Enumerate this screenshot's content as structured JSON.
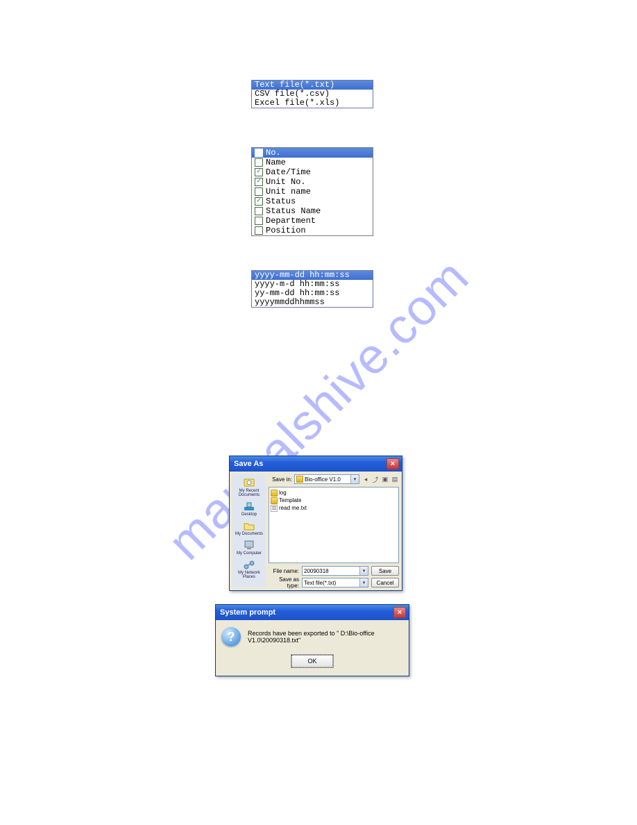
{
  "watermark": "manualshive.com",
  "filetype_list": {
    "items": [
      {
        "label": "Text file(*.txt)",
        "selected": true
      },
      {
        "label": "CSV file(*.csv)",
        "selected": false
      },
      {
        "label": "Excel file(*.xls)",
        "selected": false
      }
    ]
  },
  "field_list": {
    "items": [
      {
        "label": "No.",
        "checked": true,
        "selected": true
      },
      {
        "label": "Name",
        "checked": false,
        "selected": false
      },
      {
        "label": "Date/Time",
        "checked": true,
        "selected": false
      },
      {
        "label": "Unit No.",
        "checked": true,
        "selected": false
      },
      {
        "label": "Unit name",
        "checked": false,
        "selected": false
      },
      {
        "label": "Status",
        "checked": true,
        "selected": false
      },
      {
        "label": "Status Name",
        "checked": false,
        "selected": false
      },
      {
        "label": "Department",
        "checked": false,
        "selected": false
      },
      {
        "label": "Position",
        "checked": false,
        "selected": false
      }
    ]
  },
  "format_list": {
    "items": [
      {
        "label": "yyyy-mm-dd hh:mm:ss",
        "selected": true
      },
      {
        "label": "yyyy-m-d hh:mm:ss",
        "selected": false
      },
      {
        "label": "yy-mm-dd hh:mm:ss",
        "selected": false
      },
      {
        "label": "yyyymmddhhmmss",
        "selected": false
      }
    ]
  },
  "save_as": {
    "title": "Save As",
    "savein_label": "Save in:",
    "savein_value": "Bio-office V1.0",
    "places": [
      {
        "label": "My Recent Documents"
      },
      {
        "label": "Desktop"
      },
      {
        "label": "My Documents"
      },
      {
        "label": "My Computer"
      },
      {
        "label": "My Network Places"
      }
    ],
    "entries": [
      {
        "type": "folder",
        "label": "log"
      },
      {
        "type": "folder",
        "label": "Template"
      },
      {
        "type": "txt",
        "label": "read me.txt"
      }
    ],
    "filename_label": "File name:",
    "filename_value": "20090318",
    "saveastype_label": "Save as type:",
    "saveastype_value": "Text file(*.txt)",
    "save_btn": "Save",
    "cancel_btn": "Cancel"
  },
  "prompt": {
    "title": "System prompt",
    "message": "Records have been exported to \" D:\\Bio-office V1.0\\20090318.txt\"",
    "ok": "OK"
  }
}
